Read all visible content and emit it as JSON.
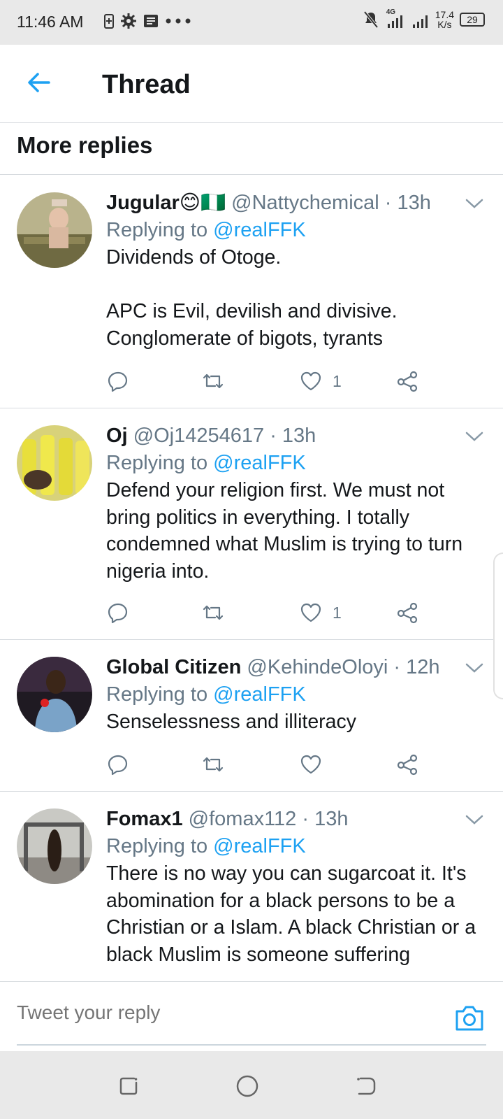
{
  "status_bar": {
    "time": "11:46 AM",
    "network": "4G",
    "speed_value": "17.4",
    "speed_unit": "K/s",
    "battery": "29"
  },
  "header": {
    "title": "Thread"
  },
  "section": {
    "title": "More replies"
  },
  "tweets": [
    {
      "name": "Jugular😊🇳🇬",
      "meta": "@Nattychemical · 13h",
      "replying_prefix": "Replying to ",
      "replying_to": "@realFFK",
      "text": "Dividends of Otoge.\n\nAPC is Evil, devilish and divisive. Conglomerate of bigots, tyrants",
      "likes": "1"
    },
    {
      "name": "Oj",
      "meta": "@Oj14254617 · 13h",
      "replying_prefix": "Replying to ",
      "replying_to": "@realFFK",
      "text": "Defend your religion first. We must not bring politics in everything. I totally condemned what Muslim is trying to turn nigeria into.",
      "likes": "1"
    },
    {
      "name": "Global Citizen",
      "meta": "@KehindeOloyi · 12h",
      "replying_prefix": "Replying to ",
      "replying_to": "@realFFK",
      "text": "Senselessness and illiteracy",
      "likes": ""
    },
    {
      "name": "Fomax1",
      "meta": "@fomax112 · 13h",
      "replying_prefix": "Replying to ",
      "replying_to": "@realFFK",
      "text": "There is no way you can sugarcoat it. It's abomination for a black persons to be a Christian or a Islam. A black Christian or a black Muslim is someone suffering",
      "likes": ""
    }
  ],
  "reply_bar": {
    "placeholder": "Tweet your reply"
  },
  "colors": {
    "accent": "#1da1f2",
    "text": "#14171a",
    "secondary": "#657786",
    "divider": "#d7dbdf"
  }
}
